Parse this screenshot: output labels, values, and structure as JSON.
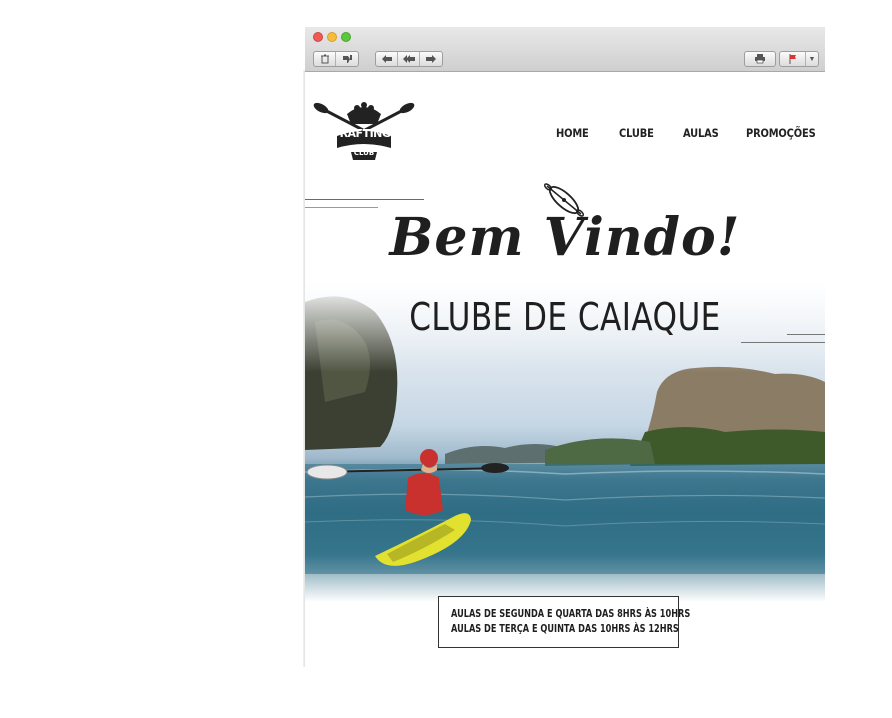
{
  "window": {
    "toolbar": {
      "left_group": [
        "trash-icon",
        "thumbs-down-icon"
      ],
      "nav_group": [
        "reply-icon",
        "reply-all-icon",
        "forward-icon"
      ],
      "right_group": [
        "print-icon",
        "flag-icon"
      ]
    }
  },
  "logo": {
    "line1": "RAFTING",
    "line2": "CLUB"
  },
  "nav": {
    "items": [
      "HOME",
      "CLUBE",
      "AULAS",
      "PROMOÇÕES"
    ]
  },
  "hero": {
    "title": "Bem Vindo!",
    "subtitle": "CLUBE DE CAIAQUE"
  },
  "schedule": {
    "line1": "AULAS DE SEGUNDA E QUARTA DAS 8HRS ÀS 10HRS",
    "line2": "AULAS DE TERÇA E QUINTA DAS 10HRS ÀS 12HRS"
  },
  "colors": {
    "text": "#1f1f1f",
    "toolbar": "#d6d6d6",
    "kayak": "#e3e130",
    "jacket": "#c8312e"
  }
}
